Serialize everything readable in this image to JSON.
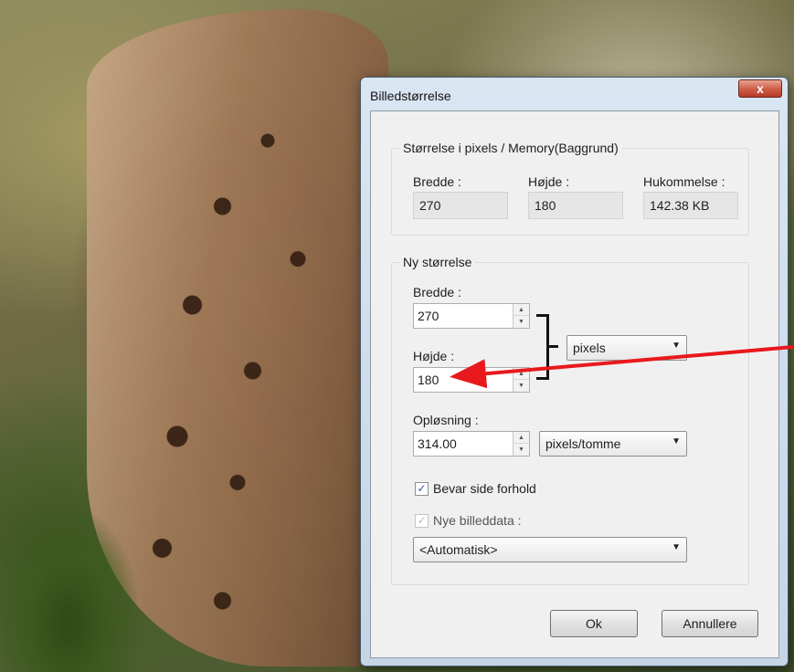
{
  "dialog": {
    "title": "Billedstørrelse",
    "close_label": "x",
    "current": {
      "legend": "Størrelse i pixels / Memory(Baggrund)",
      "width_label": "Bredde :",
      "width_value": "270",
      "height_label": "Højde :",
      "height_value": "180",
      "memory_label": "Hukommelse :",
      "memory_value": "142.38 KB"
    },
    "new_size": {
      "legend": "Ny størrelse",
      "width_label": "Bredde :",
      "width_value": "270",
      "height_label": "Højde :",
      "height_value": "180",
      "unit_value": "pixels",
      "resolution_label": "Opløsning :",
      "resolution_value": "314.00",
      "resolution_unit_value": "pixels/tomme",
      "keep_ratio_label": "Bevar side forhold",
      "keep_ratio_checked": true,
      "new_data_label": "Nye billeddata :",
      "new_data_checked": true,
      "new_data_value": "<Automatisk>"
    },
    "ok_label": "Ok",
    "cancel_label": "Annullere"
  },
  "annotation": {
    "arrow_color": "#e8191c",
    "bracket_color": "#111111"
  }
}
